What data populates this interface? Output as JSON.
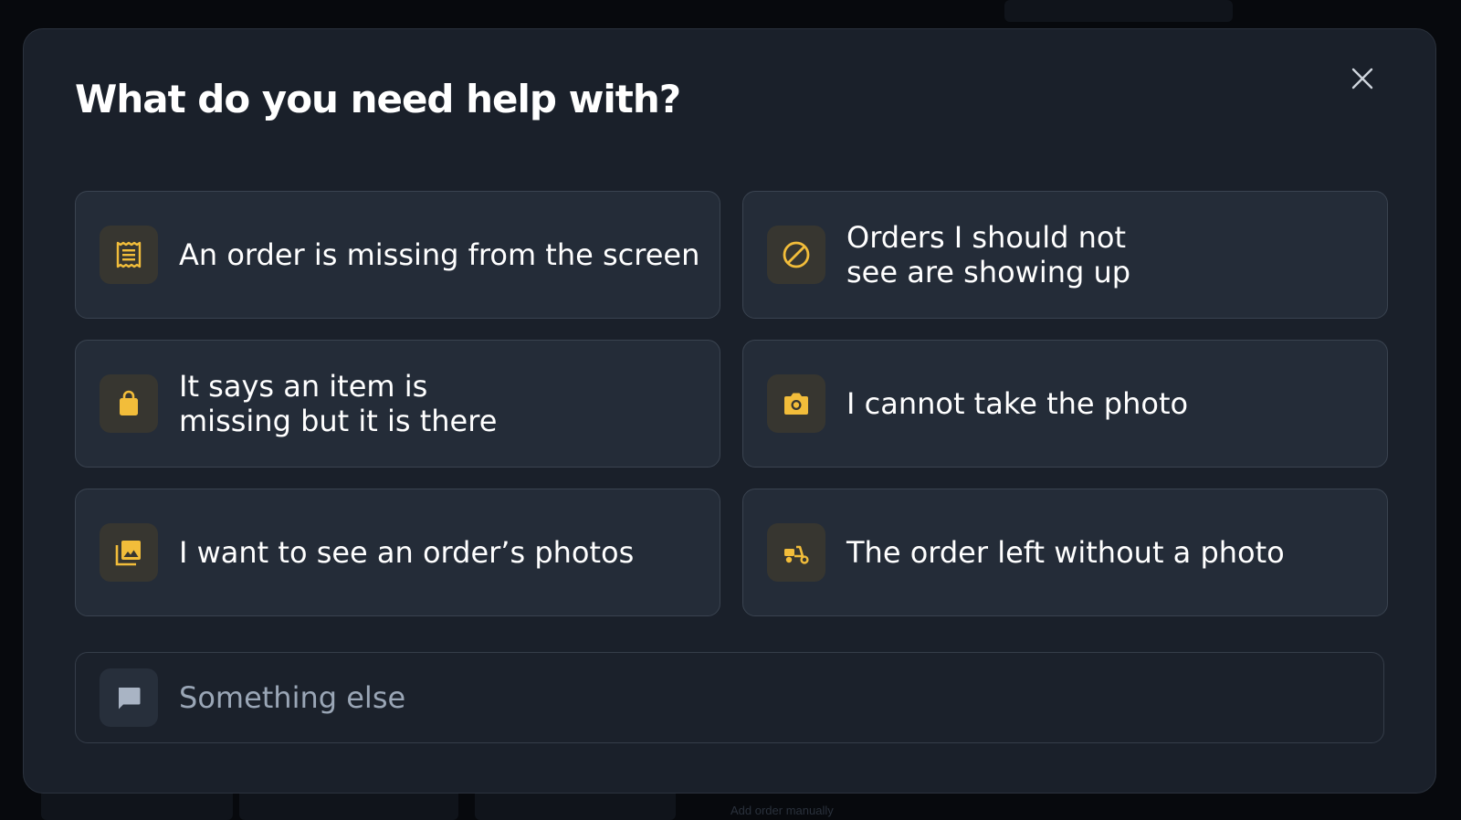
{
  "backdrop": {
    "hint_text": "Add order manually"
  },
  "dialog": {
    "title": "What do you need help with?",
    "close_icon": "close-icon",
    "accent_color": "#f2bd3a",
    "options": [
      {
        "label": "An order is missing from the screen",
        "icon": "receipt-icon"
      },
      {
        "label": "Orders I should not\nsee are showing up",
        "icon": "blocked-icon"
      },
      {
        "label": "It says an item is\nmissing but it is there",
        "icon": "shopping-bag-icon"
      },
      {
        "label": "I cannot take the photo",
        "icon": "camera-icon"
      },
      {
        "label": "I want to see an order’s photos",
        "icon": "photo-library-icon"
      },
      {
        "label": "The order left without a photo",
        "icon": "delivery-scooter-icon"
      }
    ],
    "other_option": {
      "label": "Something else",
      "icon": "chat-icon"
    }
  }
}
